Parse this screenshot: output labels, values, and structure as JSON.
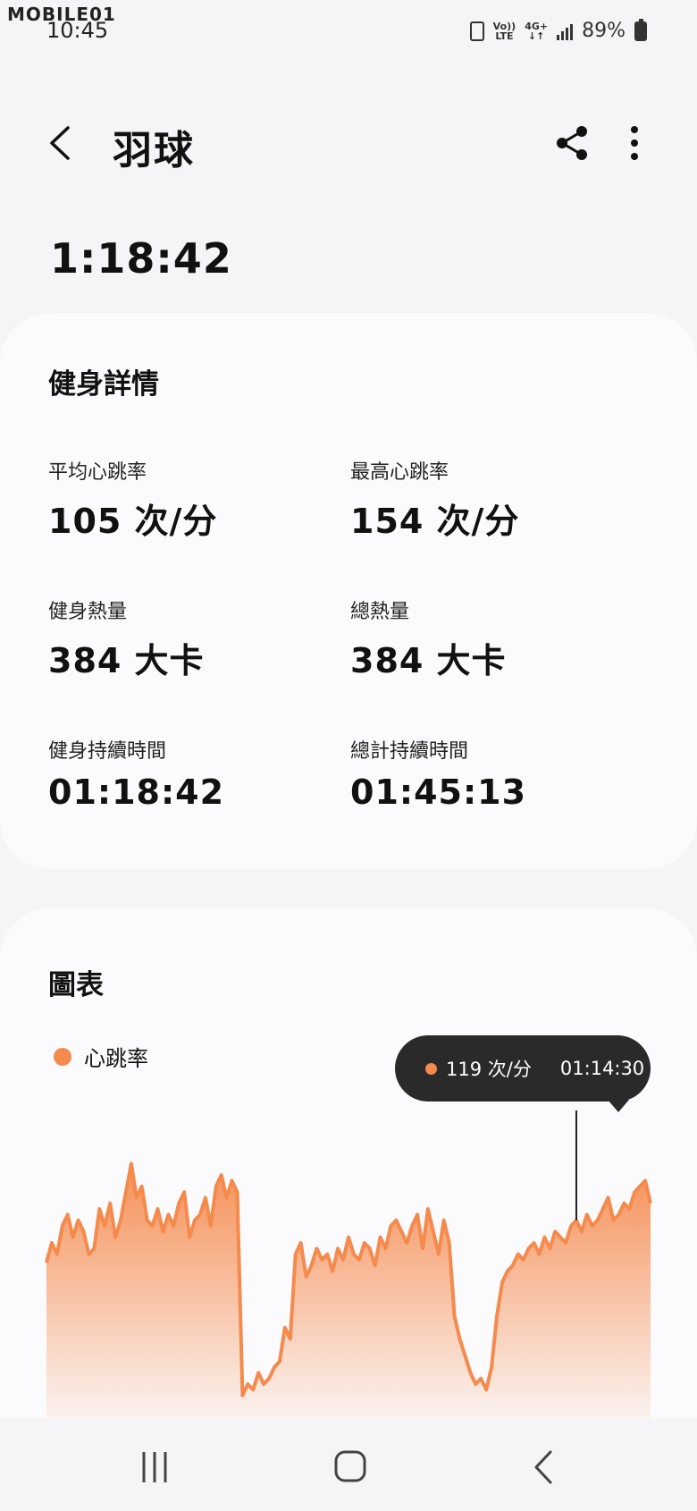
{
  "status_bar": {
    "watermark": "MOBILE01",
    "time": "10:45",
    "volte_line1": "Vo))",
    "volte_line2": "LTE",
    "network_line1": "4G+",
    "network_line2": "↓↑",
    "battery": "89%"
  },
  "header": {
    "title": "羽球",
    "back_icon": "chevron-left-icon",
    "share_icon": "share-icon",
    "more_icon": "more-vertical-icon"
  },
  "workout_duration": "1:18:42",
  "details": {
    "title": "健身詳情",
    "stats": [
      {
        "label": "平均心跳率",
        "value": "105 次/分"
      },
      {
        "label": "最高心跳率",
        "value": "154 次/分"
      },
      {
        "label": "健身熱量",
        "value": "384 大卡"
      },
      {
        "label": "總熱量",
        "value": "384 大卡"
      },
      {
        "label": "健身持續時間",
        "value": "01:18:42"
      },
      {
        "label": "總計持續時間",
        "value": "01:45:13"
      }
    ]
  },
  "chart_section": {
    "title": "圖表",
    "legend_label": "心跳率",
    "accent_color": "#f58a4d",
    "tooltip": {
      "value": "119 次/分",
      "time": "01:14:30"
    }
  },
  "chart_data": {
    "type": "area",
    "series": [
      {
        "name": "心跳率",
        "values": [
          115,
          122,
          118,
          128,
          132,
          124,
          130,
          126,
          118,
          120,
          134,
          128,
          136,
          124,
          130,
          140,
          150,
          138,
          142,
          130,
          128,
          134,
          126,
          132,
          128,
          136,
          140,
          124,
          130,
          132,
          138,
          128,
          142,
          146,
          138,
          144,
          140,
          68,
          72,
          70,
          76,
          72,
          74,
          78,
          80,
          92,
          88,
          118,
          122,
          110,
          114,
          120,
          116,
          118,
          112,
          120,
          116,
          124,
          118,
          116,
          122,
          120,
          114,
          124,
          120,
          128,
          130,
          126,
          122,
          128,
          132,
          120,
          134,
          126,
          118,
          130,
          122,
          96,
          88,
          82,
          76,
          72,
          74,
          70,
          78,
          96,
          108,
          112,
          114,
          118,
          116,
          120,
          122,
          118,
          124,
          120,
          126,
          124,
          122,
          128,
          130,
          126,
          132,
          128,
          130,
          134,
          138,
          130,
          132,
          136,
          134,
          140,
          142,
          144,
          136
        ]
      }
    ],
    "ylim": [
      60,
      160
    ],
    "grid": false,
    "legend": "top-left"
  },
  "nav_bar": {
    "recents_icon": "recent-apps-icon",
    "home_icon": "home-icon",
    "back_icon": "back-icon"
  }
}
